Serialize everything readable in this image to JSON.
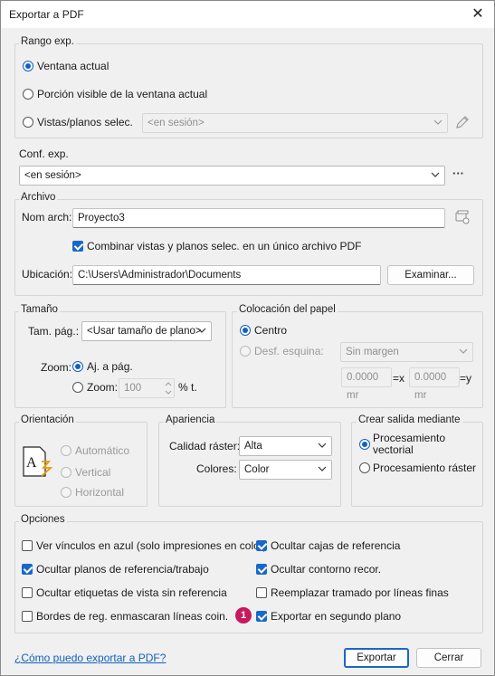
{
  "window": {
    "title": "Exportar a PDF",
    "close": "✕"
  },
  "range": {
    "label": "Rango exp.",
    "current_window": "Ventana actual",
    "visible_portion": "Porción visible de la ventana actual",
    "selected_views": "Vistas/planos selec.",
    "views_select": "<en sesión>"
  },
  "setup": {
    "label": "Conf. exp.",
    "value": "<en sesión>",
    "more": "···"
  },
  "file": {
    "label": "Archivo",
    "name_label": "Nom arch:",
    "name_value": "Proyecto3",
    "combine": "Combinar vistas y planos selec. en un único archivo PDF",
    "location_label": "Ubicación:",
    "location_value": "C:\\Users\\Administrador\\Documents",
    "browse": "Examinar..."
  },
  "size": {
    "label": "Tamaño",
    "paper_label": "Tam. pág.:",
    "paper_value": "<Usar tamaño de plano>",
    "zoom_label": "Zoom:",
    "fit_page": "Aj. a pág.",
    "zoom_option": "Zoom:",
    "zoom_value": "100",
    "zoom_unit": "% t."
  },
  "placement": {
    "label": "Colocación del papel",
    "center": "Centro",
    "offset": "Desf. esquina:",
    "margin_value": "Sin margen",
    "x_value": "0.0000 mr",
    "x_label": "=x",
    "y_value": "0.0000 mr",
    "y_label": "=y"
  },
  "orientation": {
    "label": "Orientación",
    "automatic": "Automático",
    "vertical": "Vertical",
    "horizontal": "Horizontal"
  },
  "appearance": {
    "label": "Apariencia",
    "raster_label": "Calidad ráster:",
    "raster_value": "Alta",
    "colors_label": "Colores:",
    "colors_value": "Color"
  },
  "output": {
    "label": "Crear salida mediante",
    "vector": "Procesamiento vectorial",
    "raster": "Procesamiento ráster"
  },
  "options": {
    "label": "Opciones",
    "items": [
      {
        "text": "Ver vínculos en azul (solo impresiones en color)",
        "checked": false
      },
      {
        "text": "Ocultar cajas de referencia",
        "checked": true
      },
      {
        "text": "Ocultar planos de referencia/trabajo",
        "checked": true
      },
      {
        "text": "Ocultar contorno recor.",
        "checked": true
      },
      {
        "text": "Ocultar etiquetas de vista sin referencia",
        "checked": false
      },
      {
        "text": "Reemplazar tramado por líneas finas",
        "checked": false
      },
      {
        "text": "Bordes de reg. enmascaran líneas coin.",
        "checked": false
      },
      {
        "text": "Exportar en segundo plano",
        "checked": true
      }
    ],
    "badge": "1"
  },
  "footer": {
    "help_link": "¿Cómo puedo exportar a PDF?",
    "export": "Exportar",
    "cancel": "Cerrar"
  }
}
